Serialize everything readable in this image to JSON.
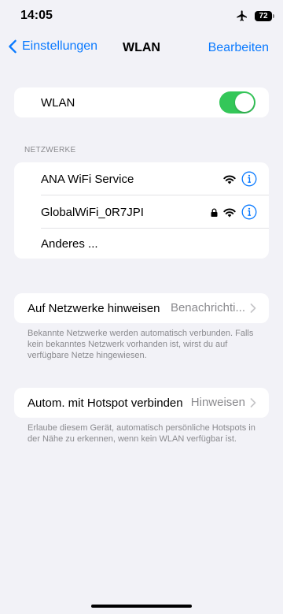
{
  "status_bar": {
    "time": "14:05",
    "battery": "72"
  },
  "nav": {
    "back_label": "Einstellungen",
    "title": "WLAN",
    "edit_label": "Bearbeiten"
  },
  "wlan": {
    "label": "WLAN",
    "enabled": true,
    "toggle_color": "#34c759"
  },
  "networks": {
    "header": "NETZWERKE",
    "items": [
      {
        "name": "ANA WiFi Service",
        "locked": false
      },
      {
        "name": "GlobalWiFi_0R7JPI",
        "locked": true
      },
      {
        "name": "Anderes ..."
      }
    ]
  },
  "notify": {
    "label": "Auf Netzwerke hinweisen",
    "value": "Benachrichti...",
    "footnote": "Bekannte Netzwerke werden automatisch verbunden. Falls kein bekanntes Netzwerk vorhanden ist, wirst du auf verfügbare Netze hingewiesen."
  },
  "hotspot": {
    "label": "Autom. mit Hotspot verbinden",
    "value": "Hinweisen",
    "footnote": "Erlaube diesem Gerät, automatisch persönliche Hotspots in der Nähe zu erkennen, wenn kein WLAN verfügbar ist."
  },
  "colors": {
    "accent": "#0a7aff",
    "background": "#f2f2f7",
    "secondary_text": "#8a8a8e"
  }
}
